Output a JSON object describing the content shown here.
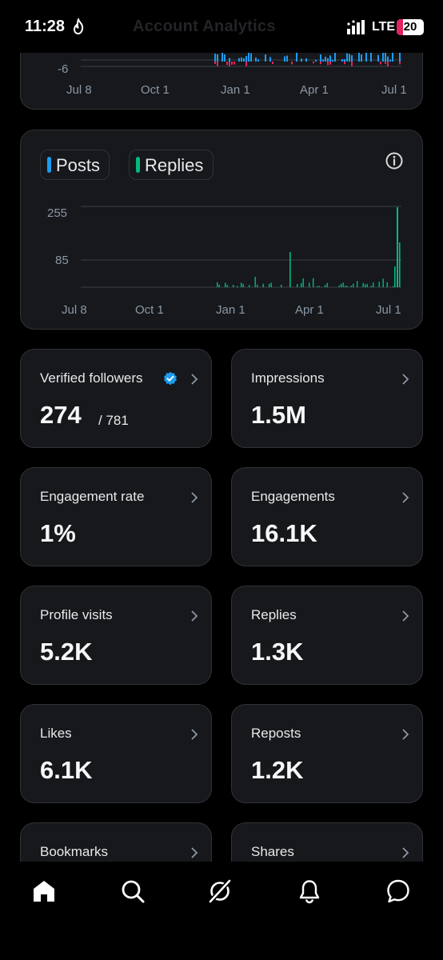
{
  "status_bar": {
    "time": "11:28",
    "network": "LTE",
    "battery": "20",
    "faded_title": "Account Analytics"
  },
  "top_chart": {
    "y_tick": "-6",
    "x_ticks": [
      "Jul 8",
      "Oct 1",
      "Jan 1",
      "Apr 1",
      "Jul 1"
    ]
  },
  "activity_chart": {
    "legend": [
      {
        "label": "Posts",
        "color": "#1d9bf0"
      },
      {
        "label": "Replies",
        "color": "#00ba7c"
      }
    ],
    "y_ticks": [
      "255",
      "85"
    ],
    "x_ticks": [
      "Jul 8",
      "Oct 1",
      "Jan 1",
      "Apr 1",
      "Jul 1"
    ]
  },
  "stats": {
    "verified_followers": {
      "title": "Verified followers",
      "value": "274",
      "total": "/ 781"
    },
    "impressions": {
      "title": "Impressions",
      "value": "1.5M"
    },
    "engagement_rate": {
      "title": "Engagement rate",
      "value": "1%"
    },
    "engagements": {
      "title": "Engagements",
      "value": "16.1K"
    },
    "profile_visits": {
      "title": "Profile visits",
      "value": "5.2K"
    },
    "replies": {
      "title": "Replies",
      "value": "1.3K"
    },
    "likes": {
      "title": "Likes",
      "value": "6.1K"
    },
    "reposts": {
      "title": "Reposts",
      "value": "1.2K"
    },
    "bookmarks": {
      "title": "Bookmarks"
    },
    "shares": {
      "title": "Shares"
    }
  },
  "nav": {
    "items": [
      "home-icon",
      "search-icon",
      "grok-icon",
      "notifications-icon",
      "messages-icon"
    ]
  }
}
